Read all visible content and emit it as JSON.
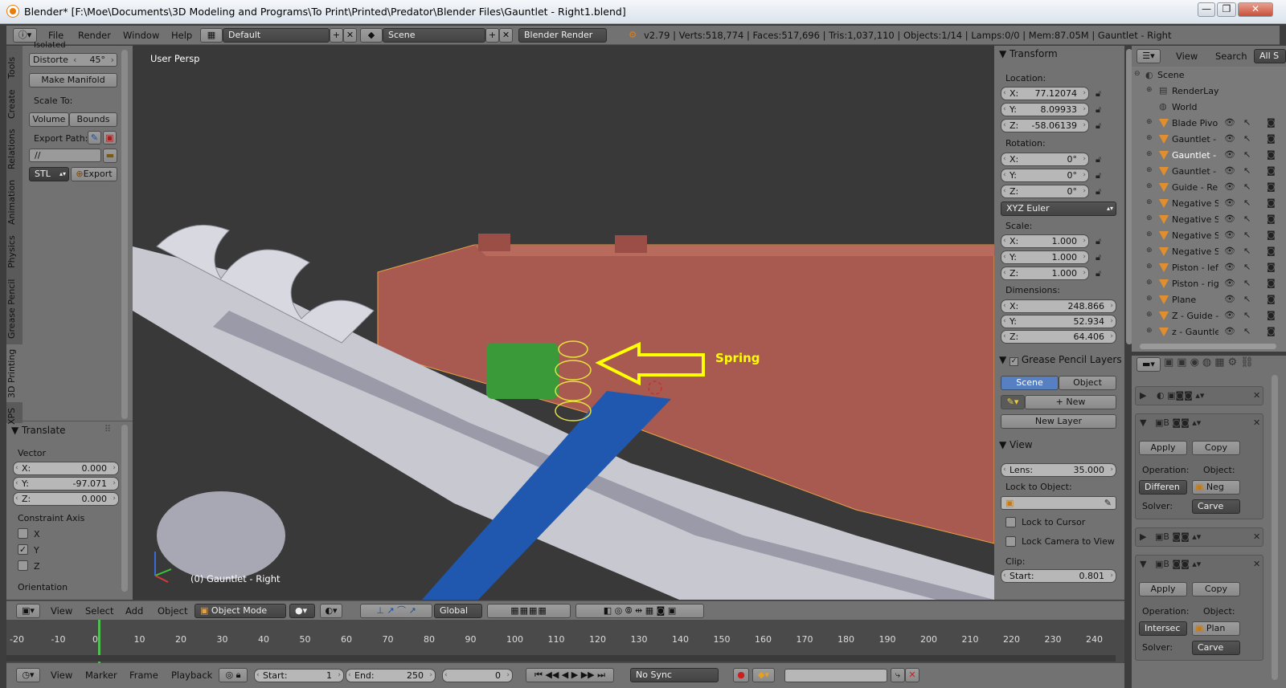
{
  "window": {
    "title": "Blender* [F:\\Moe\\Documents\\3D Modeling and Programs\\To Print\\Printed\\Predator\\Blender Files\\Gauntlet - Right1.blend]",
    "min": "—",
    "max": "❐",
    "close": "✕"
  },
  "info": {
    "menus": [
      "File",
      "Render",
      "Window",
      "Help"
    ],
    "layout": "Default",
    "scene": "Scene",
    "engine": "Blender Render",
    "stats": "v2.79 | Verts:518,774 | Faces:517,696 | Tris:1,037,110 | Objects:1/14 | Lamps:0/0 | Mem:87.05M | Gauntlet - Right"
  },
  "toolshelf": {
    "tabs": [
      "Tools",
      "Create",
      "Relations",
      "Animation",
      "Physics",
      "Grease Pencil",
      "3D Printing",
      "XPS"
    ],
    "isolated": "Isolated",
    "distort_label": "Distorte",
    "distort_value": "45°",
    "make_manifold": "Make Manifold",
    "scale_to": "Scale To:",
    "volume": "Volume",
    "bounds": "Bounds",
    "export_path": "Export Path:",
    "path_value": "//",
    "format": "STL",
    "export": "Export"
  },
  "operator": {
    "title": "Translate",
    "vector": "Vector",
    "x": "0.000",
    "y": "-97.071",
    "z": "0.000",
    "constraint": "Constraint Axis",
    "axes": [
      "X",
      "Y",
      "Z"
    ],
    "checked": [
      false,
      true,
      false
    ],
    "orientation": "Orientation"
  },
  "viewport": {
    "persp": "User Persp",
    "object_label": "(0) Gauntlet - Right",
    "annotation": "Spring",
    "annotation_color": "#ffff00"
  },
  "npanel": {
    "transform": "Transform",
    "location": "Location:",
    "loc": [
      "77.12074",
      "8.09933",
      "-58.06139"
    ],
    "rotation": "Rotation:",
    "rot": [
      "0°",
      "0°",
      "0°"
    ],
    "euler": "XYZ Euler",
    "scale": "Scale:",
    "scl": [
      "1.000",
      "1.000",
      "1.000"
    ],
    "dimensions": "Dimensions:",
    "dim": [
      "248.866",
      "52.934",
      "64.406"
    ],
    "axes": [
      "X:",
      "Y:",
      "Z:"
    ],
    "gp": "Grease Pencil Layers",
    "scene_btn": "Scene",
    "object_btn": "Object",
    "new": "New",
    "new_layer": "New Layer",
    "view": "View",
    "lens_label": "Lens:",
    "lens": "35.000",
    "lock_object": "Lock to Object:",
    "lock_cursor": "Lock to Cursor",
    "lock_camera": "Lock Camera to View",
    "clip": "Clip:",
    "start_label": "Start:",
    "start": "0.801"
  },
  "outliner": {
    "view": "View",
    "search": "Search",
    "all": "All S",
    "scene": "Scene",
    "items": [
      "RenderLay",
      "World",
      "Blade Pivo",
      "Gauntlet -",
      "Gauntlet -",
      "Gauntlet -",
      "Guide - Re",
      "Negative S",
      "Negative S",
      "Negative S",
      "Negative S",
      "Piston - lef",
      "Piston - rig",
      "Plane",
      "Z - Guide -",
      "z - Gauntle"
    ]
  },
  "props": {
    "apply": "Apply",
    "copy": "Copy",
    "operation": "Operation:",
    "object": "Object:",
    "solver": "Solver:",
    "op1": "Differen",
    "obj1": "Neg",
    "solver1": "Carve",
    "op2": "Intersec",
    "obj2": "Plan",
    "solver2": "Carve"
  },
  "vheader": {
    "menus": [
      "View",
      "Select",
      "Add",
      "Object"
    ],
    "mode": "Object Mode",
    "orientation": "Global"
  },
  "timeline": {
    "ticks": [
      "-20",
      "-10",
      "0",
      "10",
      "20",
      "30",
      "40",
      "50",
      "60",
      "70",
      "80",
      "90",
      "100",
      "110",
      "120",
      "130",
      "140",
      "150",
      "160",
      "170",
      "180",
      "190",
      "200",
      "210",
      "220",
      "230",
      "240"
    ],
    "menus": [
      "View",
      "Marker",
      "Frame",
      "Playback"
    ],
    "start_label": "Start:",
    "start": "1",
    "end_label": "End:",
    "end": "250",
    "current": "0",
    "sync": "No Sync"
  }
}
